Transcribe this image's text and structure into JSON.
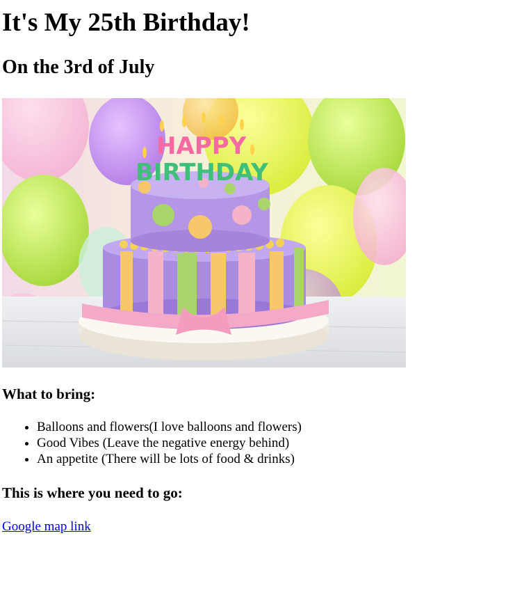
{
  "title": "It's My 25th Birthday!",
  "date_line": "On the 3rd of July",
  "hero_image": {
    "icon": "birthday-cake-image",
    "candle_text_top": "HAPPY",
    "candle_text_bottom": "BIRTHDAY"
  },
  "bring": {
    "heading": "What to bring:",
    "items": [
      "Balloons and flowers(I love balloons and flowers)",
      "Good Vibes (Leave the negative energy behind)",
      "An appetite (There will be lots of food & drinks)"
    ]
  },
  "location": {
    "heading": "This is where you need to go:",
    "link_text": "Google map link"
  },
  "colors": {
    "link": "#0000ee",
    "text": "#000000"
  }
}
